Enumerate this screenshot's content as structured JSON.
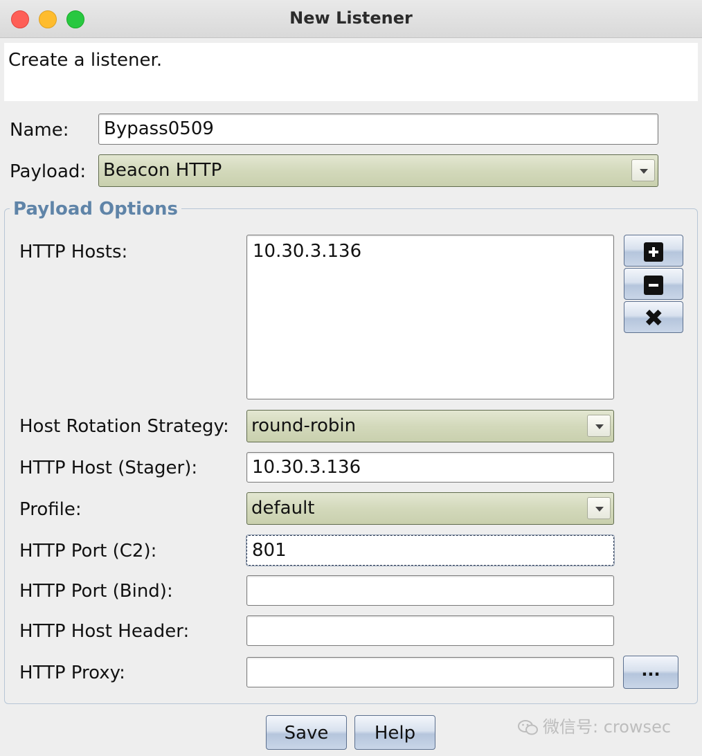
{
  "window": {
    "title": "New Listener"
  },
  "description": "Create a listener.",
  "name": {
    "label": "Name:",
    "value": "Bypass0509"
  },
  "payload": {
    "label": "Payload:",
    "value": "Beacon HTTP"
  },
  "payload_options": {
    "title": "Payload Options",
    "http_hosts": {
      "label": "HTTP Hosts:",
      "items": [
        "10.30.3.136"
      ]
    },
    "host_rotation": {
      "label": "Host Rotation Strategy:",
      "value": "round-robin"
    },
    "http_host_stager": {
      "label": "HTTP Host (Stager):",
      "value": "10.30.3.136"
    },
    "profile": {
      "label": "Profile:",
      "value": "default"
    },
    "http_port_c2": {
      "label": "HTTP Port (C2):",
      "value": "801"
    },
    "http_port_bind": {
      "label": "HTTP Port (Bind):",
      "value": ""
    },
    "http_host_header": {
      "label": "HTTP Host Header:",
      "value": ""
    },
    "http_proxy": {
      "label": "HTTP Proxy:",
      "value": "",
      "browse_label": "..."
    }
  },
  "buttons": {
    "save": "Save",
    "help": "Help"
  },
  "watermark": "微信号: crowsec",
  "icons": [
    "close-light",
    "minimize-light",
    "zoom-light",
    "plus-icon",
    "minus-icon",
    "x-icon",
    "wechat-icon"
  ],
  "colors": {
    "group_title": "#5f84a8",
    "combo_bg": "#d3d9bb",
    "button_bg": "#c9d6e8"
  }
}
